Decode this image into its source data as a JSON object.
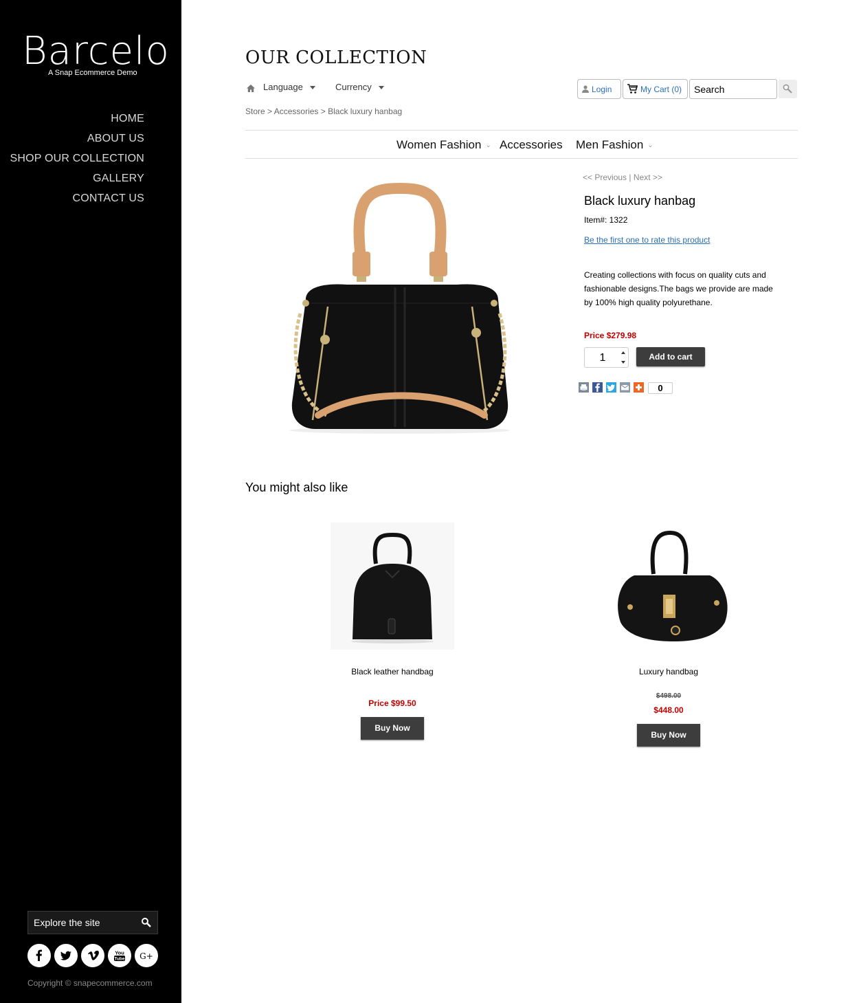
{
  "brand": {
    "name": "Barcelo",
    "tagline": "A Snap Ecommerce Demo"
  },
  "sidebar": {
    "nav": [
      "HOME",
      "ABOUT US",
      "SHOP OUR COLLECTION",
      "GALLERY",
      "CONTACT US"
    ],
    "explore_placeholder": "Explore the site",
    "socials": [
      "facebook-icon",
      "twitter-icon",
      "vimeo-icon",
      "youtube-icon",
      "google-plus-icon"
    ],
    "youtube_text": [
      "You",
      "Tube"
    ],
    "google_plus_text": "G+",
    "copyright": "Copyright © snapecommerce.com"
  },
  "header": {
    "title": "OUR COLLECTION",
    "language": "Language",
    "currency": "Currency",
    "login": "Login",
    "cart": "My Cart (0)",
    "search_placeholder": "Search"
  },
  "breadcrumb": {
    "store": "Store",
    "sep": ">",
    "category": "Accessories",
    "current": "Black luxury hanbag"
  },
  "categories": [
    {
      "label": "Women Fashion",
      "has_dropdown": true
    },
    {
      "label": "Accessories",
      "has_dropdown": false
    },
    {
      "label": "Men Fashion",
      "has_dropdown": true
    }
  ],
  "product": {
    "prev": "<< Previous",
    "sep": "|",
    "next": "Next >>",
    "name": "Black luxury hanbag",
    "item": "Item#: 1322",
    "rate": "Be the first one to rate this product",
    "description": "Creating collections with focus on quality cuts and fashionable designs.The bags we provide are made by 100% high quality polyurethane.",
    "price": "Price $279.98",
    "quantity": "1",
    "add_to_cart": "Add to cart",
    "share_count": "0"
  },
  "related": {
    "title": "You might also like",
    "items": [
      {
        "name": "Black leather handbag",
        "price": "Price $99.50",
        "old_price": "",
        "buy": "Buy Now"
      },
      {
        "name": "Luxury handbag",
        "price": "$448.00",
        "old_price": "$498.00",
        "buy": "Buy Now"
      }
    ]
  },
  "colors": {
    "sidebar_bg": "#000000",
    "price_red": "#c40000",
    "link_blue": "#2a6fb8",
    "button_dark": "#3d3d3d"
  }
}
